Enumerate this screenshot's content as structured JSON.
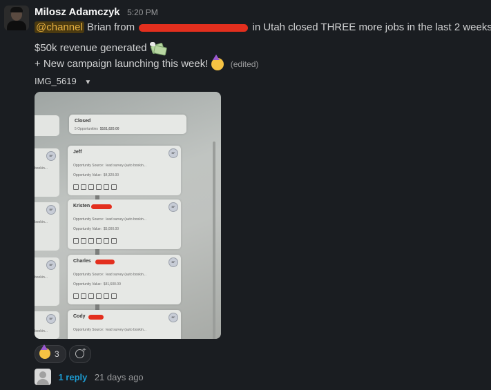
{
  "message": {
    "author": "Milosz Adamczyk",
    "time": "5:20 PM",
    "mention": "@channel",
    "text_a": "Brian from",
    "text_b": "in Utah closed THREE more jobs in the last 2 weeks!!",
    "line2": "$50k revenue generated",
    "line3": "+ New campaign launching this week!",
    "edited": "(edited)",
    "emoji_money": "money-with-wings",
    "emoji_party": "partying-face"
  },
  "attachment": {
    "filename": "IMG_5619",
    "closed_card": {
      "title": "Closed",
      "subtitle": "5 Opportunities",
      "amount": "$161,620.00"
    },
    "cards": [
      {
        "name": "Jeff",
        "source_label": "Opportunity Source:",
        "source": "lead survey (auto bookin...",
        "value_label": "Opportunity Value:",
        "value": "$4,320.00"
      },
      {
        "name": "Kristen",
        "source_label": "Opportunity Source:",
        "source": "lead survey (auto bookin...",
        "value_label": "Opportunity Value:",
        "value": "$5,000.00"
      },
      {
        "name": "Charles",
        "source_label": "Opportunity Source:",
        "source": "lead survey (auto bookin...",
        "value_label": "Opportunity Value:",
        "value": "$41,600.00"
      },
      {
        "name": "Cody",
        "source_label": "Opportunity Source:",
        "source": "lead survey (auto bookin..."
      }
    ],
    "side_text": [
      "bookin...",
      "bookin...",
      "bookin...",
      "bookin..."
    ]
  },
  "reactions": [
    {
      "emoji": "partying-face",
      "count": "3"
    }
  ],
  "thread": {
    "replies": "1 reply",
    "ago": "21 days ago"
  }
}
